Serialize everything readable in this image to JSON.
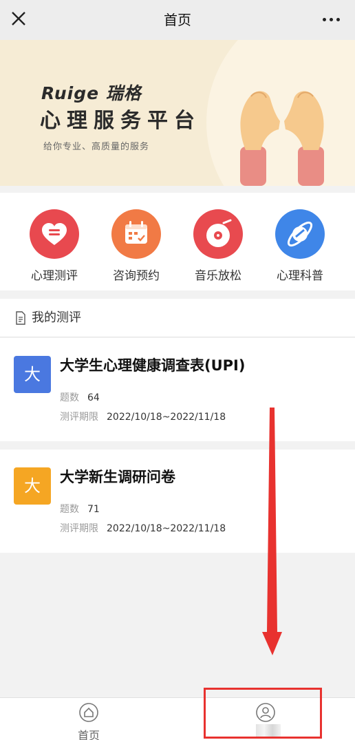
{
  "topbar": {
    "title": "首页",
    "close_icon": "close-icon",
    "more_icon": "more-icon"
  },
  "banner": {
    "brand": "Ruige 瑞格",
    "headline": "心理服务平台",
    "slogan": "给你专业、高质量的服务"
  },
  "quick_entries": [
    {
      "label": "心理测评",
      "icon": "heart-icon",
      "color": "#e8494f"
    },
    {
      "label": "咨询预约",
      "icon": "calendar-icon",
      "color": "#f17a45"
    },
    {
      "label": "音乐放松",
      "icon": "record-icon",
      "color": "#e84a4f"
    },
    {
      "label": "心理科普",
      "icon": "planet-icon",
      "color": "#3f86e8"
    }
  ],
  "my_tests": {
    "title": "我的测评",
    "items": [
      {
        "badge": "大",
        "badge_color": "#4a78e0",
        "name": "大学生心理健康调查表(UPI)",
        "count_label": "题数",
        "count": "64",
        "period_label": "测评期限",
        "period": "2022/10/18~2022/11/18"
      },
      {
        "badge": "大",
        "badge_color": "#f5a623",
        "name": "大学新生调研问卷",
        "count_label": "题数",
        "count": "71",
        "period_label": "测评期限",
        "period": "2022/10/18~2022/11/18"
      }
    ]
  },
  "tabbar": {
    "tabs": [
      {
        "label": "首页",
        "icon": "home-icon"
      },
      {
        "label": "",
        "icon": "user-icon"
      }
    ]
  },
  "annotation": {
    "arrow_color": "#e8322f",
    "box_color": "#e8322f"
  }
}
